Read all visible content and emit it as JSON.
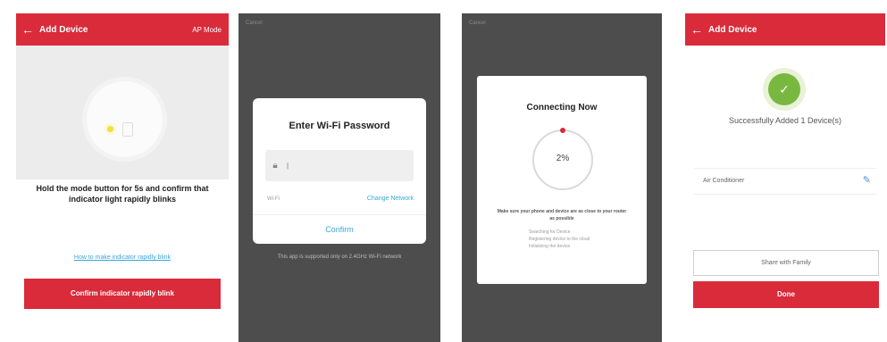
{
  "screen1": {
    "title": "Add Device",
    "top_right": "AP Mode",
    "hint": "Hold the mode button for 5s and confirm that indicator light rapidly blinks",
    "help_link": "How to make indicator rapidly blink",
    "confirm_button": "Confirm indicator rapidly blink"
  },
  "screen2": {
    "top_label": "Cancel",
    "modal_title": "Enter Wi-Fi Password",
    "password_placeholder": "|",
    "wifi_label": "Wi-Fi",
    "change_network": "Change Network",
    "confirm": "Confirm",
    "note": "This app is supported only on 2.4GHz Wi-Fi network"
  },
  "screen3": {
    "top_label": "Cancel",
    "title": "Connecting Now",
    "progress": "2%",
    "description": "Make sure your phone and device are as close to your router as possible",
    "steps": [
      "Searching for Device",
      "Registering device to the cloud",
      "Initializing the device"
    ]
  },
  "screen4": {
    "title": "Add Device",
    "success": "Successfully Added 1 Device(s)",
    "device_name": "Air Conditioner",
    "share_button": "Share with Family",
    "done_button": "Done"
  },
  "colors": {
    "accent": "#d92b3a",
    "link": "#3aa6d8",
    "success": "#79b840",
    "overlay": "#4d4d4d"
  }
}
